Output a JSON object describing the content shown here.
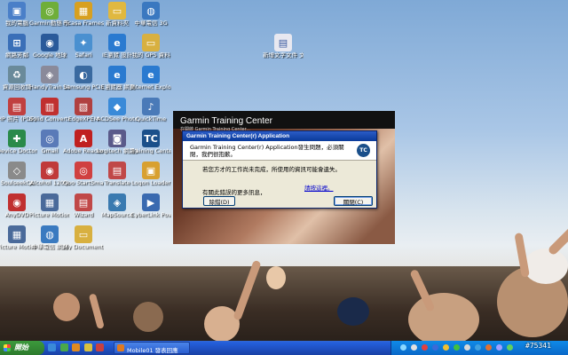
{
  "desktop": {
    "icons": [
      {
        "label": "我的電腦",
        "name": "my-computer",
        "color": "#4a7fc8",
        "glyph": "▣"
      },
      {
        "label": "Garmin動態 示選",
        "name": "garmin-express",
        "color": "#6fae3a",
        "glyph": "◎"
      },
      {
        "label": "Picasa Frames",
        "name": "picasa-frames",
        "color": "#d8a020",
        "glyph": "▦"
      },
      {
        "label": "新資料夾",
        "name": "new-folder",
        "color": "#e0b840",
        "glyph": "▭"
      },
      {
        "label": "中華電信 3G",
        "name": "cht-3g",
        "color": "#3a78c0",
        "glyph": "◍"
      },
      {
        "label": "網路芳鄰",
        "name": "network-places",
        "color": "#3a6fb8",
        "glyph": "⊞"
      },
      {
        "label": "Google 地球",
        "name": "google-earth",
        "color": "#2a5a9a",
        "glyph": "◉"
      },
      {
        "label": "Safari",
        "name": "safari",
        "color": "#4a90d0",
        "glyph": "✦"
      },
      {
        "label": "IE瀏覽 設計",
        "name": "ie-designer",
        "color": "#2a7ad0",
        "glyph": "e"
      },
      {
        "label": "我的 GPS 資料",
        "name": "gps-data",
        "color": "#d8b040",
        "glyph": "▭"
      },
      {
        "label": "資源回收筒",
        "name": "recycle-bin",
        "color": "#6a8a9a",
        "glyph": "♻"
      },
      {
        "label": "HandyTrain Utility",
        "name": "handytrain",
        "color": "#8a8a9a",
        "glyph": "◈"
      },
      {
        "label": "Samsung PC Studio 3",
        "name": "samsung-pc-studio",
        "color": "#3a6aa0",
        "glyph": "◐"
      },
      {
        "label": "IE瀏覽器 網頁",
        "name": "ie-browser",
        "color": "#2a7ad0",
        "glyph": "e"
      },
      {
        "label": "Internet Explorer",
        "name": "internet-explorer",
        "color": "#2a7ad0",
        "glyph": "e"
      },
      {
        "label": "HP 照片 (PDF)",
        "name": "hp-photo",
        "color": "#c04040",
        "glyph": "▤"
      },
      {
        "label": "Solid Converter PDF",
        "name": "solid-converter",
        "color": "#c03030",
        "glyph": "▥"
      },
      {
        "label": "EdgeXPEM",
        "name": "edgexpem",
        "color": "#b04040",
        "glyph": "▧"
      },
      {
        "label": "ACDSee Photo",
        "name": "acdsee",
        "color": "#3a8ad8",
        "glyph": "◆"
      },
      {
        "label": "QuickTime",
        "name": "quicktime",
        "color": "#4a7ab8",
        "glyph": "♪"
      },
      {
        "label": "Device Doctor",
        "name": "device-doctor",
        "color": "#2a8a4a",
        "glyph": "✚"
      },
      {
        "label": "Gmail",
        "name": "gmail",
        "color": "#5a7ab8",
        "glyph": "◎"
      },
      {
        "label": "Adobe Reader 9.0",
        "name": "adobe-reader",
        "color": "#c02020",
        "glyph": "A"
      },
      {
        "label": "Logitech 網路攝影機",
        "name": "logitech",
        "color": "#5a5a8a",
        "glyph": "◙"
      },
      {
        "label": "Training Center",
        "name": "training-center",
        "color": "#1a4f8a",
        "glyph": "TC"
      },
      {
        "label": "SoulseekQt",
        "name": "soulseek",
        "color": "#8a8a8a",
        "glyph": "◇"
      },
      {
        "label": "Alcohol 120%",
        "name": "alcohol",
        "color": "#c03a3a",
        "glyph": "◉"
      },
      {
        "label": "Qoo StartSmart",
        "name": "qoo-startsmart",
        "color": "#d04040",
        "glyph": "◎"
      },
      {
        "label": "Translate",
        "name": "translate",
        "color": "#c04848",
        "glyph": "▤"
      },
      {
        "label": "Logon Loader",
        "name": "logon-loader",
        "color": "#d8a030",
        "glyph": "▣"
      },
      {
        "label": "AnyDVD",
        "name": "anydvd",
        "color": "#c03030",
        "glyph": "◉"
      },
      {
        "label": "Picture Motion Browser",
        "name": "picture-motion",
        "color": "#4a6a9a",
        "glyph": "▦"
      },
      {
        "label": "Wizard",
        "name": "wizard",
        "color": "#c04848",
        "glyph": "▤"
      },
      {
        "label": "MapSource",
        "name": "mapsource",
        "color": "#3a7ab0",
        "glyph": "◈"
      },
      {
        "label": "CyberLink PowerDVD",
        "name": "powerdvd",
        "color": "#3a6ab0",
        "glyph": "▶"
      },
      {
        "label": "Picture Motion Browser",
        "name": "picture-motion-2",
        "color": "#4a6a9a",
        "glyph": "▦"
      },
      {
        "label": "中華電信 網路",
        "name": "cht-network",
        "color": "#3a7ac0",
        "glyph": "◍"
      },
      {
        "label": "My Documents",
        "name": "my-documents",
        "color": "#d8b040",
        "glyph": "▭"
      },
      {
        "label": "新增文字文件 文件夾",
        "name": "new-text-doc",
        "color": "#e8e8f0",
        "glyph": "▤"
      }
    ]
  },
  "splash": {
    "title": "Garmin Training Center",
    "subtitle": "在開啟 Garmin Training Center..."
  },
  "dialog": {
    "title": "Garmin Training Center(r) Application",
    "message": "Garmin Training Center(r) Application發生問題，必須關閉，我們很抱歉。",
    "logo": "TC",
    "warning": "若您方才的工作尚未完成，所使用的資訊可能會遺失。",
    "link": "請按這裡。",
    "info": "有關此錯誤的更多訊息，",
    "debug_button": "除錯(D)",
    "close_button": "關閉(C)"
  },
  "taskbar": {
    "start_label": "開始",
    "task_label": "Mobile01 發表回應",
    "badge": "#75341"
  }
}
